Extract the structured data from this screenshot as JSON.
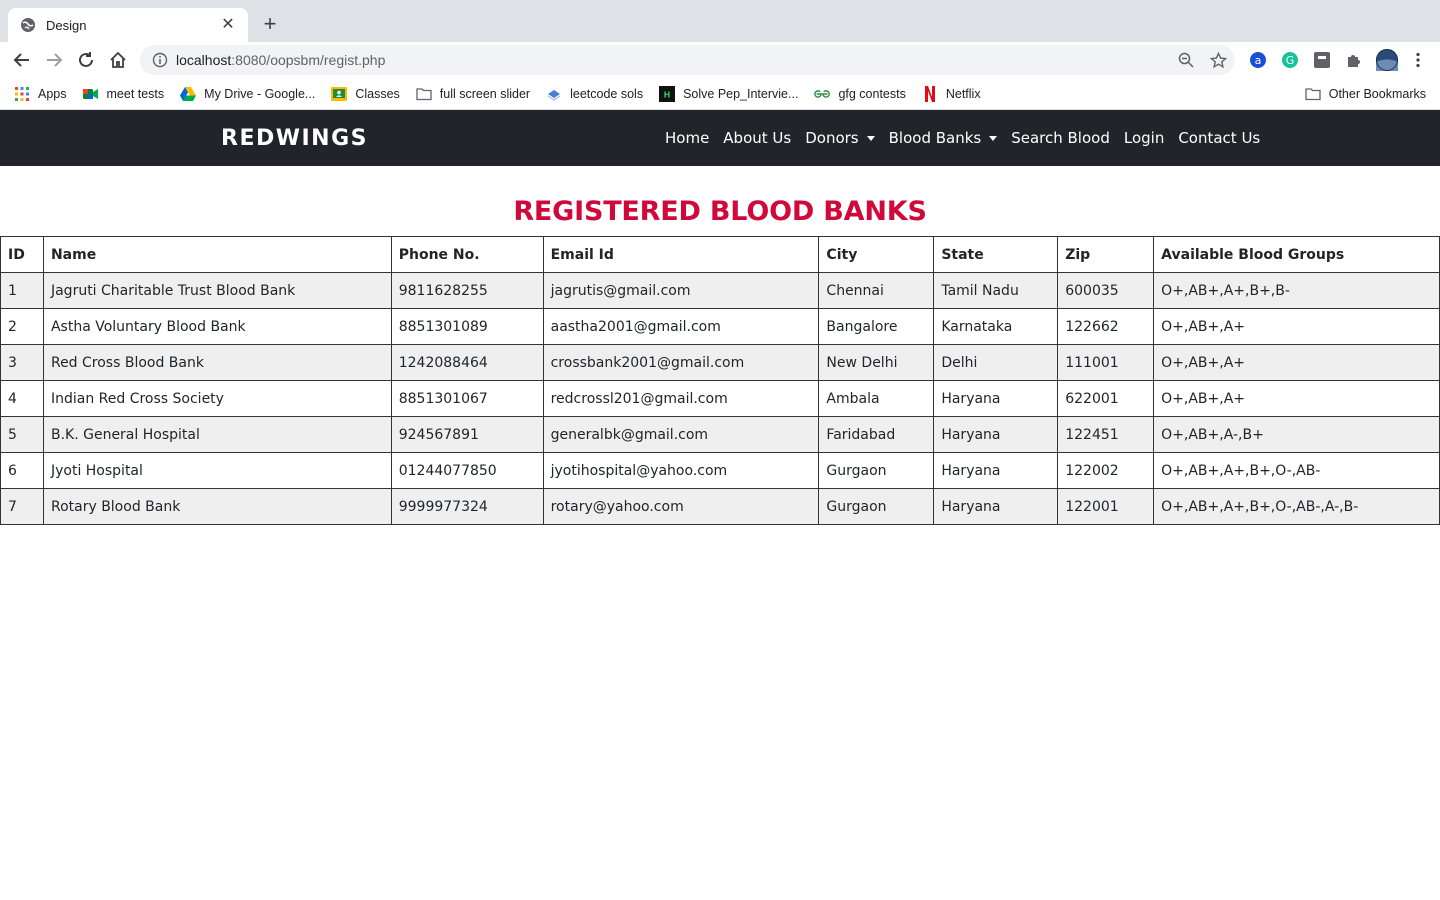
{
  "browser": {
    "tab_title": "Design",
    "url_host": "localhost",
    "url_path": ":8080/oopsbm/regist.php",
    "bookmarks": [
      {
        "label": "Apps",
        "icon": "apps-grid-icon"
      },
      {
        "label": "meet tests",
        "icon": "google-meet-icon"
      },
      {
        "label": "My Drive - Google...",
        "icon": "google-drive-icon"
      },
      {
        "label": "Classes",
        "icon": "classroom-icon"
      },
      {
        "label": "full screen slider",
        "icon": "folder-icon"
      },
      {
        "label": "leetcode sols",
        "icon": "leetcode-icon"
      },
      {
        "label": "Solve Pep_Intervie...",
        "icon": "hackerrank-icon"
      },
      {
        "label": "gfg contests",
        "icon": "gfg-icon"
      },
      {
        "label": "Netflix",
        "icon": "netflix-icon"
      }
    ],
    "other_bookmarks": "Other Bookmarks"
  },
  "site": {
    "brand": "REDWINGS",
    "nav": [
      {
        "label": "Home",
        "dropdown": false
      },
      {
        "label": "About Us",
        "dropdown": false
      },
      {
        "label": "Donors",
        "dropdown": true
      },
      {
        "label": "Blood Banks",
        "dropdown": true
      },
      {
        "label": "Search Blood",
        "dropdown": false
      },
      {
        "label": "Login",
        "dropdown": false
      },
      {
        "label": "Contact Us",
        "dropdown": false
      }
    ]
  },
  "main": {
    "title": "REGISTERED BLOOD BANKS",
    "columns": [
      "ID",
      "Name",
      "Phone No.",
      "Email Id",
      "City",
      "State",
      "Zip",
      "Available Blood Groups"
    ],
    "rows": [
      [
        "1",
        "Jagruti Charitable Trust Blood Bank",
        "9811628255",
        "jagrutis@gmail.com",
        "Chennai",
        "Tamil Nadu",
        "600035",
        "O+,AB+,A+,B+,B-"
      ],
      [
        "2",
        "Astha Voluntary Blood Bank",
        "8851301089",
        "aastha2001@gmail.com",
        "Bangalore",
        "Karnataka",
        "122662",
        "O+,AB+,A+"
      ],
      [
        "3",
        "Red Cross Blood Bank",
        "1242088464",
        "crossbank2001@gmail.com",
        "New Delhi",
        "Delhi",
        "111001",
        "O+,AB+,A+"
      ],
      [
        "4",
        "Indian Red Cross Society",
        "8851301067",
        "redcrossl201@gmail.com",
        "Ambala",
        "Haryana",
        "622001",
        "O+,AB+,A+"
      ],
      [
        "5",
        "B.K. General Hospital",
        "924567891",
        "generalbk@gmail.com",
        "Faridabad",
        "Haryana",
        "122451",
        "O+,AB+,A-,B+"
      ],
      [
        "6",
        "Jyoti Hospital",
        "01244077850",
        "jyotihospital@yahoo.com",
        "Gurgaon",
        "Haryana",
        "122002",
        "O+,AB+,A+,B+,O-,AB-"
      ],
      [
        "7",
        "Rotary Blood Bank",
        "9999977324",
        "rotary@yahoo.com",
        "Gurgaon",
        "Haryana",
        "122001",
        "O+,AB+,A+,B+,O-,AB-,A-,B-"
      ]
    ]
  },
  "colors": {
    "navbar_bg": "#212529",
    "title_red": "#d1083a",
    "stripe": "#efefef"
  }
}
